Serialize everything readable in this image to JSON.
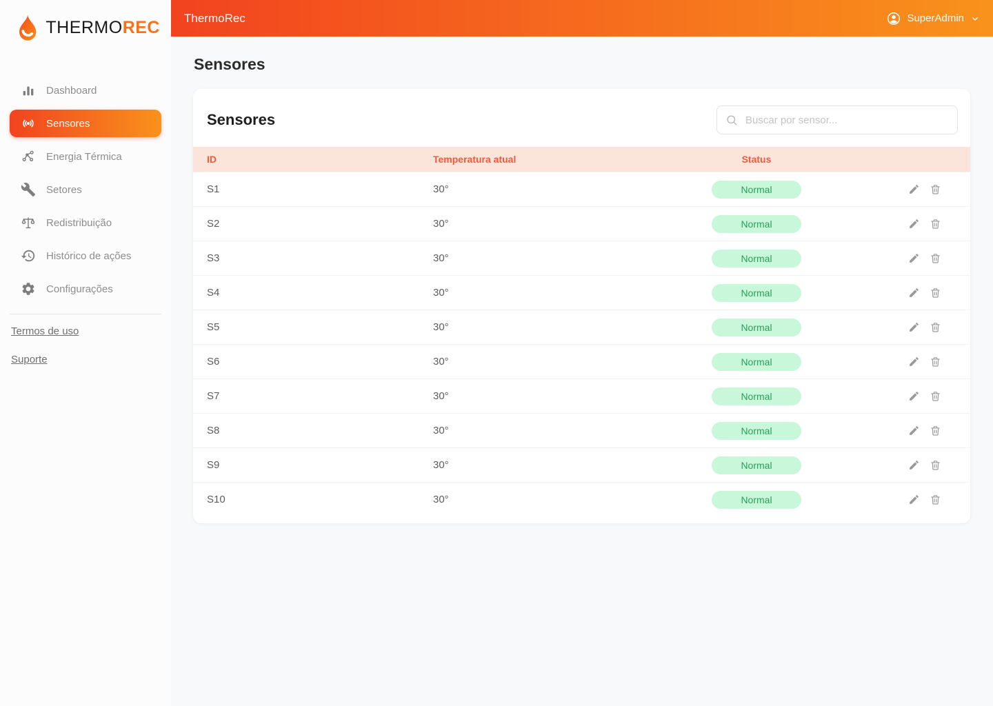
{
  "brand": {
    "primary": "THERMO",
    "accent": "REC"
  },
  "topbar": {
    "title": "ThermoRec",
    "user_label": "SuperAdmin"
  },
  "sidebar": {
    "items": [
      {
        "label": "Dashboard"
      },
      {
        "label": "Sensores"
      },
      {
        "label": "Energia Térmica"
      },
      {
        "label": "Setores"
      },
      {
        "label": "Redistribuição"
      },
      {
        "label": "Histórico de ações"
      },
      {
        "label": "Configurações"
      }
    ],
    "links": [
      {
        "label": "Termos de uso"
      },
      {
        "label": "Suporte"
      }
    ]
  },
  "page": {
    "title": "Sensores"
  },
  "panel": {
    "title": "Sensores",
    "search_placeholder": "Buscar por sensor..."
  },
  "table": {
    "columns": {
      "id": "ID",
      "temperature": "Temperatura atual",
      "status": "Status"
    },
    "rows": [
      {
        "id": "S1",
        "temperature": "30°",
        "status": "Normal"
      },
      {
        "id": "S2",
        "temperature": "30°",
        "status": "Normal"
      },
      {
        "id": "S3",
        "temperature": "30°",
        "status": "Normal"
      },
      {
        "id": "S4",
        "temperature": "30°",
        "status": "Normal"
      },
      {
        "id": "S5",
        "temperature": "30°",
        "status": "Normal"
      },
      {
        "id": "S6",
        "temperature": "30°",
        "status": "Normal"
      },
      {
        "id": "S7",
        "temperature": "30°",
        "status": "Normal"
      },
      {
        "id": "S8",
        "temperature": "30°",
        "status": "Normal"
      },
      {
        "id": "S9",
        "temperature": "30°",
        "status": "Normal"
      },
      {
        "id": "S10",
        "temperature": "30°",
        "status": "Normal"
      }
    ]
  },
  "colors": {
    "gradient_start": "#f2431f",
    "gradient_end": "#f9921c",
    "badge_bg": "#c9f7d9",
    "badge_text": "#2aa05c",
    "table_header_bg": "#fbe4da",
    "table_header_text": "#f05a3c"
  }
}
